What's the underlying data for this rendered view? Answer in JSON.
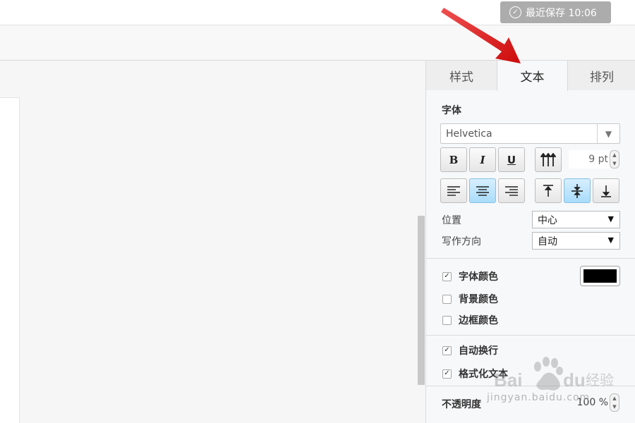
{
  "topbar": {
    "save_status": "最近保存 10:06",
    "save_icon": "check-circle-icon"
  },
  "panel": {
    "tabs": [
      {
        "label": "样式",
        "active": false
      },
      {
        "label": "文本",
        "active": true
      },
      {
        "label": "排列",
        "active": false
      }
    ],
    "font_section_title": "字体",
    "font_family": "Helvetica",
    "format_buttons": {
      "bold": "B",
      "italic": "I",
      "underline": "U"
    },
    "font_size": "9 pt",
    "align_horizontal": {
      "left": "left-align-icon",
      "center": "center-align-icon",
      "right": "right-align-icon",
      "selected": "center"
    },
    "align_vertical": {
      "top": "align-top-icon",
      "middle": "align-middle-icon",
      "bottom": "align-bottom-icon",
      "selected": "middle"
    },
    "position_label": "位置",
    "position_value": "中心",
    "direction_label": "写作方向",
    "direction_value": "自动",
    "font_color_label": "字体颜色",
    "font_color_checked": true,
    "font_color_value": "#000000",
    "background_color_label": "背景颜色",
    "background_color_checked": false,
    "border_color_label": "边框颜色",
    "border_color_checked": false,
    "wrap_label": "自动换行",
    "wrap_checked": true,
    "formatted_text_label": "格式化文本",
    "formatted_text_checked": true,
    "opacity_label": "不透明度",
    "opacity_value": "100 %"
  },
  "watermark": {
    "brand": "Baidu经验",
    "url": "jingyan.baidu.com"
  },
  "colors": {
    "accent_button": "#a9dcfb",
    "save_badge": "#acacac",
    "annotation_arrow": "#e11414"
  }
}
